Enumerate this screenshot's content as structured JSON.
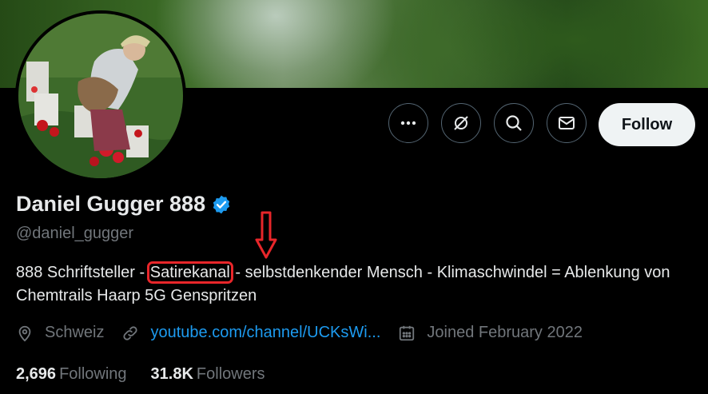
{
  "profile": {
    "name": "Daniel Gugger 888",
    "handle": "@daniel_gugger",
    "bio_before": "888 Schriftsteller - ",
    "bio_highlight": "Satirekanal",
    "bio_after": " - selbstdenkender Mensch -  Klimaschwindel = Ablenkung von Chemtrails Haarp 5G Genspritzen",
    "verified_icon": "verified-badge-icon",
    "location": "Schweiz",
    "website": "youtube.com/channel/UCKsWi...",
    "joined": "Joined February 2022"
  },
  "actions": {
    "more_icon": "more-icon",
    "grok_icon": "grok-icon",
    "search_icon": "search-icon",
    "message_icon": "message-icon",
    "follow_label": "Follow"
  },
  "stats": {
    "following_count": "2,696",
    "following_label": "Following",
    "followers_count": "31.8K",
    "followers_label": "Followers"
  },
  "colors": {
    "accent": "#1d9bf0",
    "annotation": "#e8262a",
    "background": "#000000"
  }
}
